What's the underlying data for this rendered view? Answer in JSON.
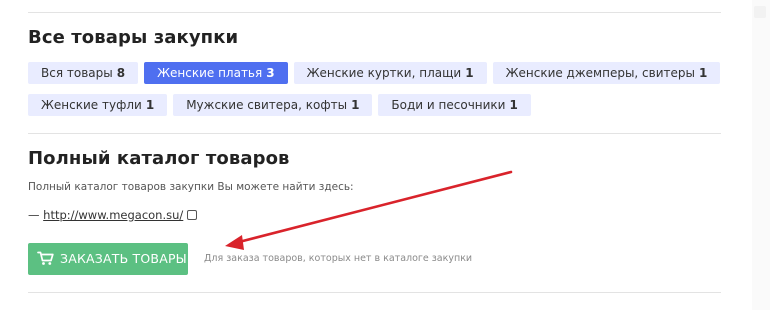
{
  "section_all": {
    "title": "Все товары закупки",
    "tags_row1": [
      {
        "label": "Вся товары",
        "count": "8",
        "active": false
      },
      {
        "label": "Женские платья",
        "count": "3",
        "active": true
      },
      {
        "label": "Женские куртки, плащи",
        "count": "1",
        "active": false
      },
      {
        "label": "Женские джемперы, свитеры",
        "count": "1",
        "active": false
      }
    ],
    "tags_row2": [
      {
        "label": "Женские туфли",
        "count": "1",
        "active": false
      },
      {
        "label": "Мужские свитера, кофты",
        "count": "1",
        "active": false
      },
      {
        "label": "Боди и песочники",
        "count": "1",
        "active": false
      }
    ]
  },
  "section_catalog": {
    "title": "Полный каталог товаров",
    "description": "Полный каталог товаров закупки Вы можете найти здесь:",
    "link_prefix": "— ",
    "link_text": "http://www.megacon.su/",
    "order_button": "ЗАКАЗАТЬ ТОВАРЫ",
    "order_note": "Для заказа товаров, которых нет в каталоге закупки"
  },
  "colors": {
    "tag_bg": "#e9ecff",
    "tag_active_bg": "#4f6ff0",
    "button_green": "#5cc082",
    "arrow_red": "#d9232b"
  },
  "icons": {
    "cart": "cart-icon",
    "external": "external-link-icon"
  }
}
